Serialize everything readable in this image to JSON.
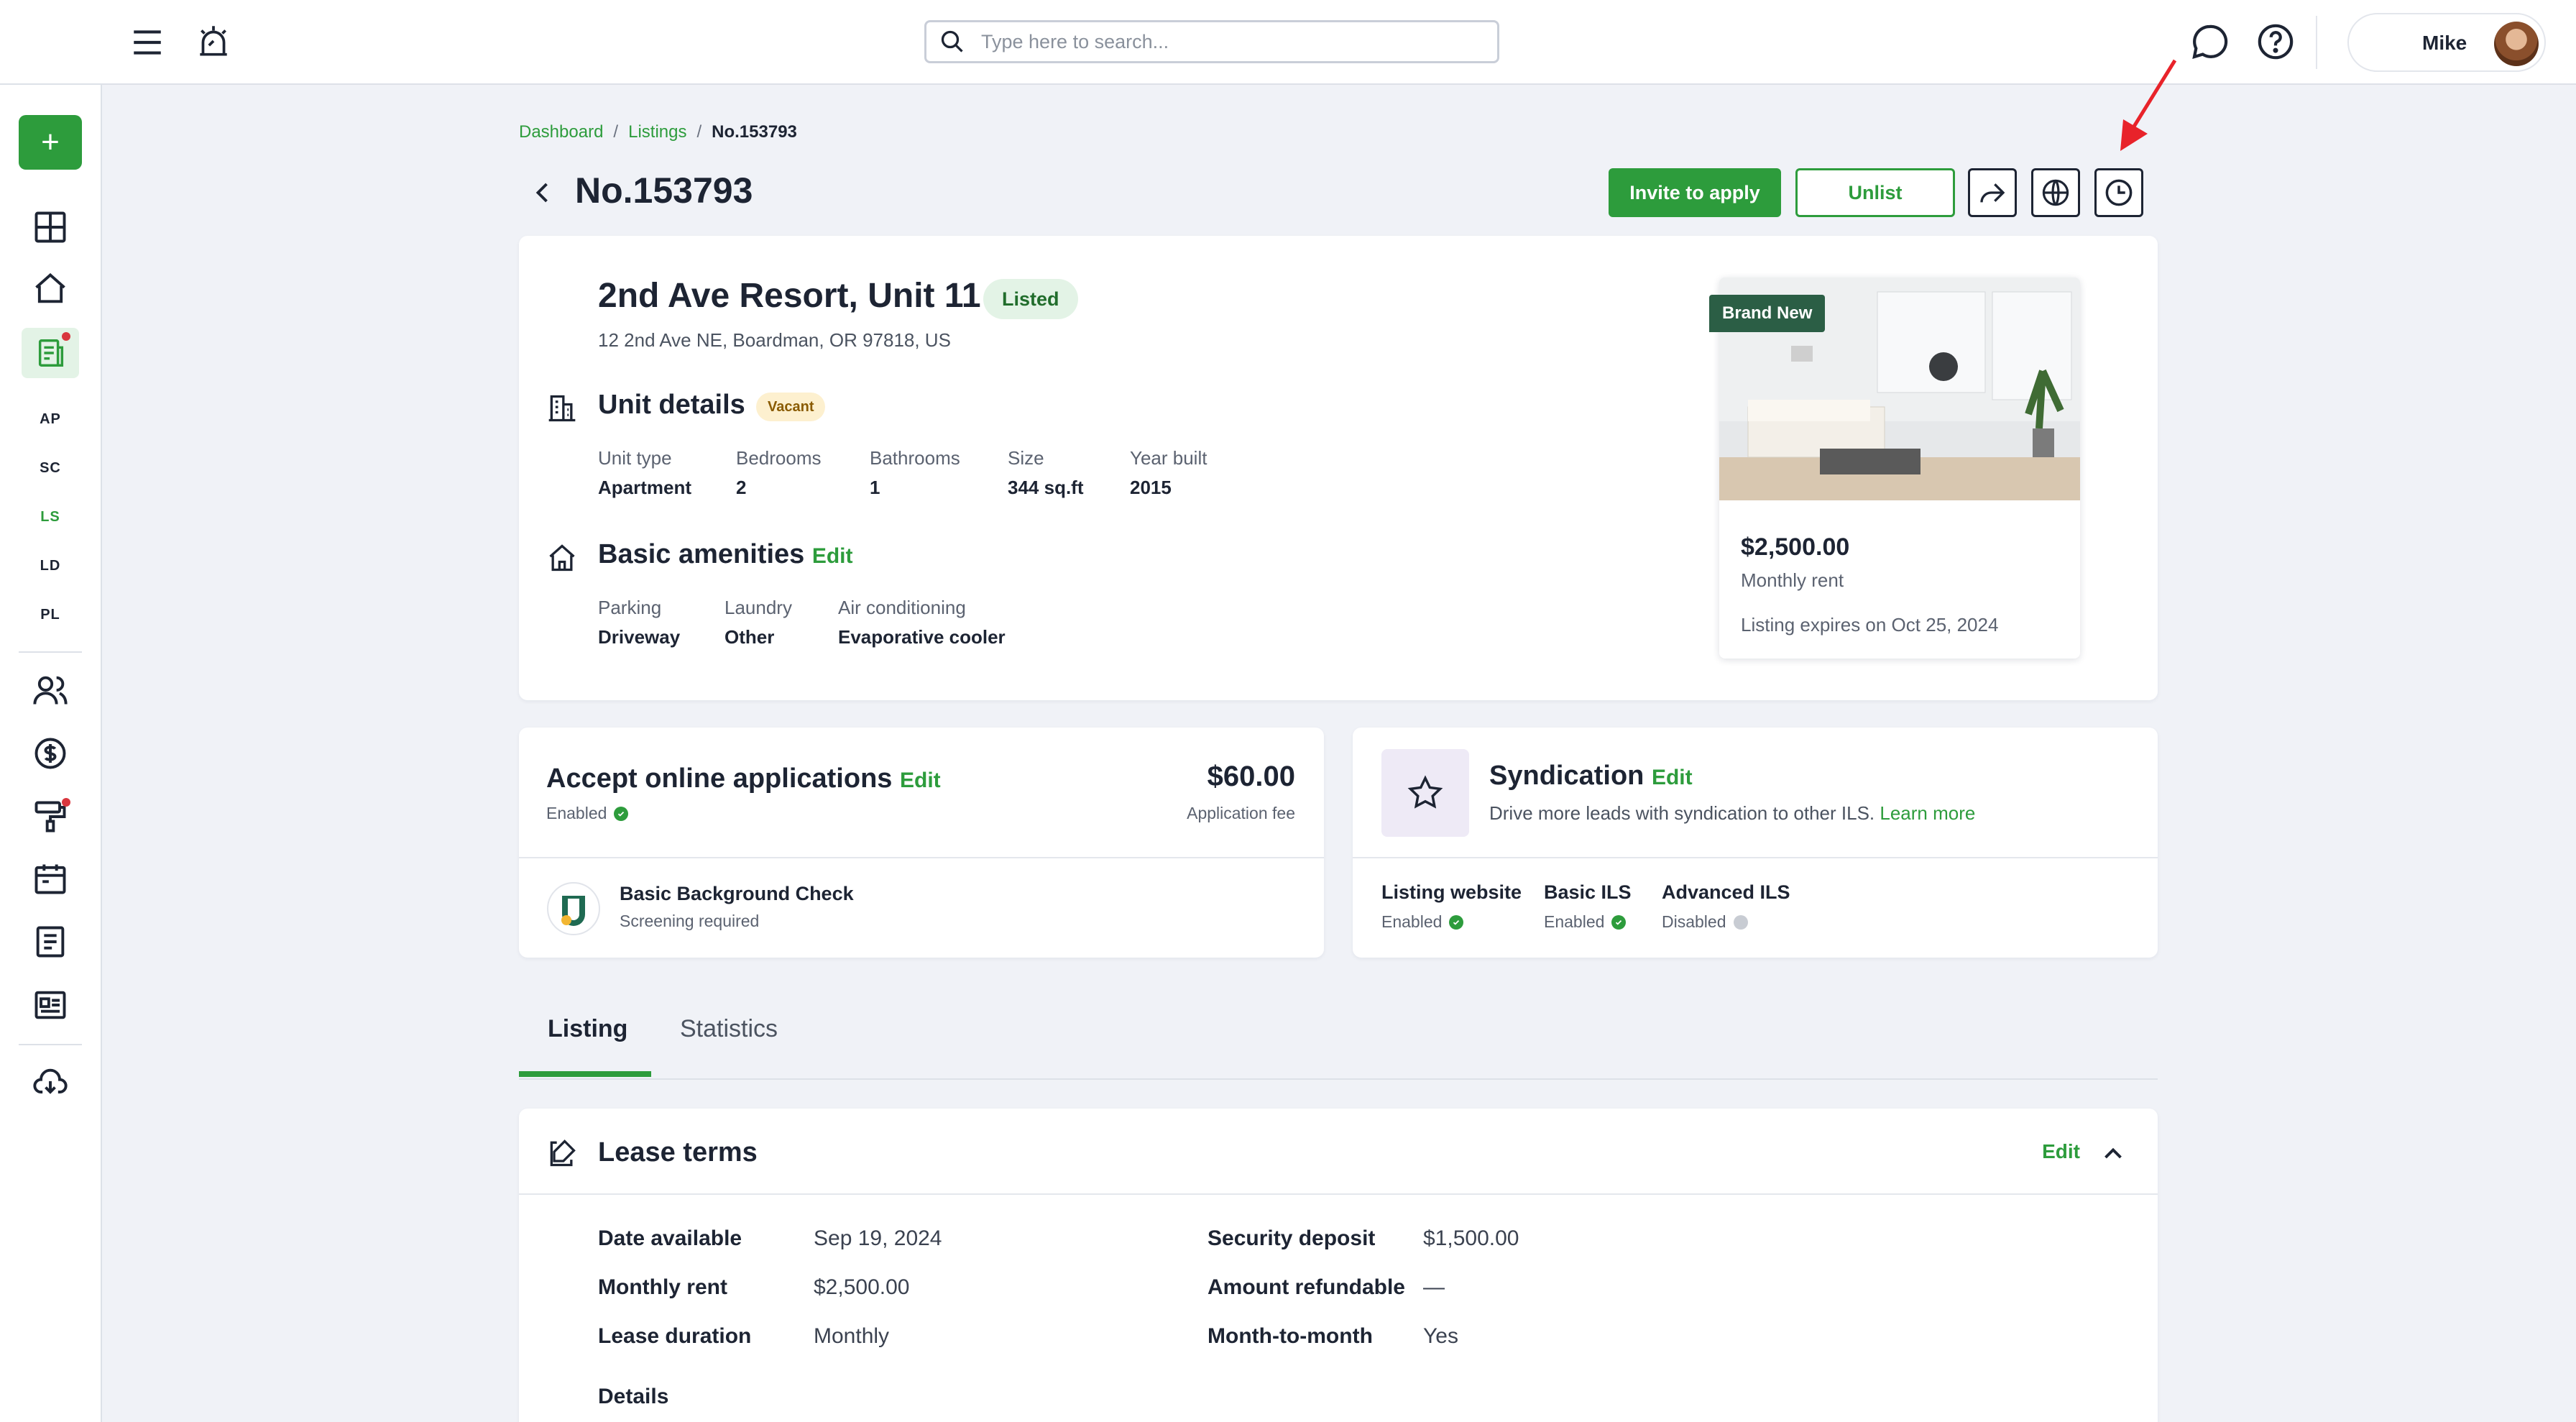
{
  "colors": {
    "brand_green": "#2d9c3c",
    "dark_text": "#1d2433",
    "background": "#f0f2f7",
    "alert_red": "#d9363e"
  },
  "topbar": {
    "search_placeholder": "Type here to search...",
    "user_name": "Mike",
    "icons": [
      "menu-icon",
      "alarm-icon",
      "search-icon",
      "chat-icon",
      "help-icon"
    ]
  },
  "sidebar": {
    "new_label": "+",
    "abbreviations": [
      "AP",
      "SC",
      "LS",
      "LD",
      "PL"
    ],
    "active_abbreviation": "LS"
  },
  "breadcrumb": {
    "dashboard": "Dashboard",
    "listings": "Listings",
    "current": "No.153793",
    "separator": "/"
  },
  "header": {
    "title": "No.153793",
    "invite_label": "Invite to apply",
    "unlist_label": "Unlist"
  },
  "unit": {
    "title": "2nd Ave Resort, Unit 11",
    "status": "Listed",
    "address": "12 2nd Ave NE, Boardman, OR 97818, US",
    "details_title": "Unit details",
    "vacancy": "Vacant",
    "details": [
      {
        "label": "Unit type",
        "value": "Apartment"
      },
      {
        "label": "Bedrooms",
        "value": "2"
      },
      {
        "label": "Bathrooms",
        "value": "1"
      },
      {
        "label": "Size",
        "value": "344 sq.ft"
      },
      {
        "label": "Year built",
        "value": "2015"
      }
    ],
    "amenities_title": "Basic amenities",
    "amenities_edit": "Edit",
    "amenities": [
      {
        "label": "Parking",
        "value": "Driveway"
      },
      {
        "label": "Laundry",
        "value": "Other"
      },
      {
        "label": "Air conditioning",
        "value": "Evaporative cooler"
      }
    ],
    "photo_badge": "Brand New",
    "rent": "$2,500.00",
    "rent_label": "Monthly rent",
    "expires": "Listing expires on Oct 25, 2024"
  },
  "applications": {
    "title": "Accept online applications",
    "edit": "Edit",
    "status": "Enabled",
    "fee": "$60.00",
    "fee_label": "Application fee",
    "check_title": "Basic Background Check",
    "check_sub": "Screening required"
  },
  "syndication": {
    "title": "Syndication",
    "edit": "Edit",
    "description": "Drive more leads with syndication to other ILS.",
    "learn_more": "Learn more",
    "items": [
      {
        "title": "Listing website",
        "status": "Enabled"
      },
      {
        "title": "Basic ILS",
        "status": "Enabled"
      },
      {
        "title": "Advanced ILS",
        "status": "Disabled"
      }
    ]
  },
  "tabs": [
    {
      "label": "Listing"
    },
    {
      "label": "Statistics"
    }
  ],
  "lease": {
    "title": "Lease terms",
    "edit": "Edit",
    "left": [
      {
        "k": "Date available",
        "v": "Sep 19, 2024"
      },
      {
        "k": "Monthly rent",
        "v": "$2,500.00"
      },
      {
        "k": "Lease duration",
        "v": "Monthly"
      }
    ],
    "right": [
      {
        "k": "Security deposit",
        "v": "$1,500.00"
      },
      {
        "k": "Amount refundable",
        "v": "—"
      },
      {
        "k": "Month-to-month",
        "v": "Yes"
      }
    ],
    "details_label": "Details"
  }
}
